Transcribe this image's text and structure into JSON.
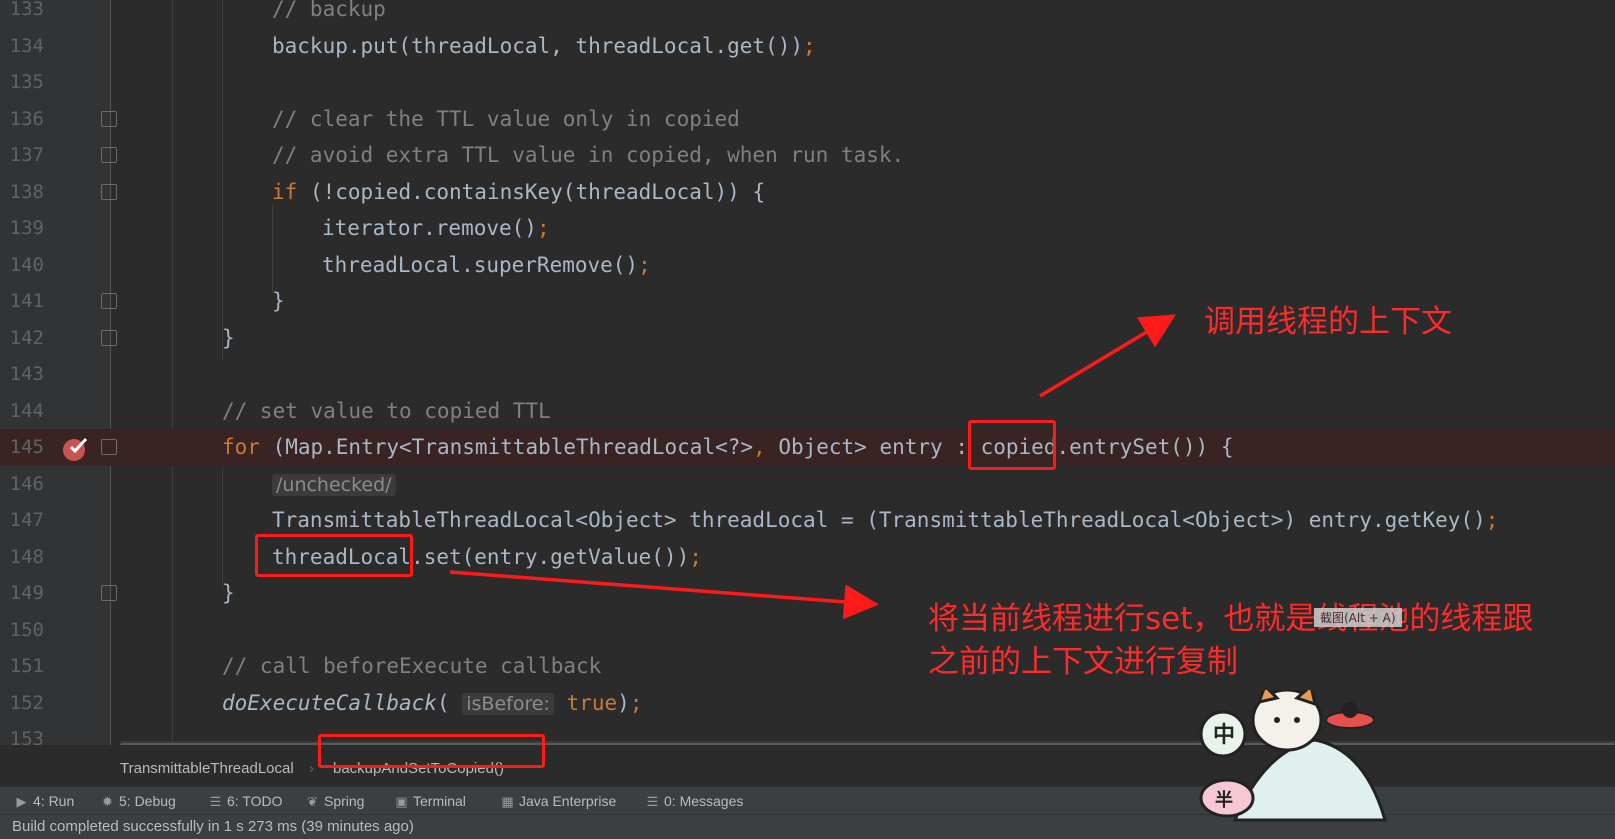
{
  "editor": {
    "lines": [
      {
        "n": "133",
        "t": [
          {
            "c": "cm",
            "v": "// backup"
          }
        ],
        "indent": 2
      },
      {
        "n": "134",
        "t": [
          {
            "c": "",
            "v": "backup.put(threadLocal, threadLocal.get())"
          },
          {
            "c": "kw",
            "v": ";"
          }
        ],
        "indent": 2
      },
      {
        "n": "135",
        "t": [],
        "indent": 2
      },
      {
        "n": "136",
        "t": [
          {
            "c": "cm",
            "v": "// clear the TTL value only in copied"
          }
        ],
        "indent": 2,
        "fold": true
      },
      {
        "n": "137",
        "t": [
          {
            "c": "cm",
            "v": "// avoid extra TTL value in copied, when run task."
          }
        ],
        "indent": 2,
        "fold": true
      },
      {
        "n": "138",
        "t": [
          {
            "c": "kw",
            "v": "if "
          },
          {
            "c": "",
            "v": "(!copied.containsKey(threadLocal)) {"
          }
        ],
        "indent": 2,
        "fold": true
      },
      {
        "n": "139",
        "t": [
          {
            "c": "",
            "v": "iterator.remove()"
          },
          {
            "c": "kw",
            "v": ";"
          }
        ],
        "indent": 3
      },
      {
        "n": "140",
        "t": [
          {
            "c": "",
            "v": "threadLocal.superRemove()"
          },
          {
            "c": "kw",
            "v": ";"
          }
        ],
        "indent": 3
      },
      {
        "n": "141",
        "t": [
          {
            "c": "",
            "v": "}"
          }
        ],
        "indent": 2,
        "fold": true
      },
      {
        "n": "142",
        "t": [
          {
            "c": "",
            "v": "}"
          }
        ],
        "indent": 1,
        "fold": true
      },
      {
        "n": "143",
        "t": [],
        "indent": 1
      },
      {
        "n": "144",
        "t": [
          {
            "c": "cm",
            "v": "// set value to copied TTL"
          }
        ],
        "indent": 1
      },
      {
        "n": "145",
        "t": [
          {
            "c": "kw",
            "v": "for "
          },
          {
            "c": "",
            "v": "(Map.Entry<TransmittableThreadLocal<?>"
          },
          {
            "c": "kw",
            "v": ", "
          },
          {
            "c": "",
            "v": "Object> entry : copied.entrySet()) {"
          }
        ],
        "indent": 1,
        "fold": true,
        "breakpoint": true
      },
      {
        "n": "146",
        "t": [
          {
            "c": "hint",
            "v": "/unchecked/"
          }
        ],
        "indent": 2
      },
      {
        "n": "147",
        "t": [
          {
            "c": "",
            "v": "TransmittableThreadLocal<Object> threadLocal = (TransmittableThreadLocal<Object>) entry.getKey()"
          },
          {
            "c": "kw",
            "v": ";"
          }
        ],
        "indent": 2
      },
      {
        "n": "148",
        "t": [
          {
            "c": "",
            "v": "threadLocal.set(entry.getValue())"
          },
          {
            "c": "kw",
            "v": ";"
          }
        ],
        "indent": 2
      },
      {
        "n": "149",
        "t": [
          {
            "c": "",
            "v": "}"
          }
        ],
        "indent": 1,
        "fold": true
      },
      {
        "n": "150",
        "t": [],
        "indent": 1
      },
      {
        "n": "151",
        "t": [
          {
            "c": "cm",
            "v": "// call beforeExecute callback"
          }
        ],
        "indent": 1
      },
      {
        "n": "152",
        "t": [
          {
            "c": "it",
            "v": "doExecuteCallback"
          },
          {
            "c": "",
            "v": "( "
          },
          {
            "c": "hint",
            "v": "isBefore:"
          },
          {
            "c": "kw",
            "v": " true"
          },
          {
            "c": "",
            "v": ")"
          },
          {
            "c": "kw",
            "v": ";"
          }
        ],
        "indent": 1
      },
      {
        "n": "153",
        "t": [],
        "indent": 1
      }
    ]
  },
  "breadcrumb": {
    "class_name": "TransmittableThreadLocal",
    "method_name": "backupAndSetToCopied()"
  },
  "toolwindows": [
    {
      "key": "run",
      "icon": "play-icon",
      "glyph": "▶",
      "label": "4: Run"
    },
    {
      "key": "debug",
      "icon": "bug-icon",
      "glyph": "✹",
      "label": "5: Debug"
    },
    {
      "key": "todo",
      "icon": "list-icon",
      "glyph": "☰",
      "label": "6: TODO"
    },
    {
      "key": "spring",
      "icon": "leaf-icon",
      "glyph": "❦",
      "label": "Spring"
    },
    {
      "key": "terminal",
      "icon": "terminal-icon",
      "glyph": "▣",
      "label": "Terminal"
    },
    {
      "key": "javaee",
      "icon": "enterprise-icon",
      "glyph": "▦",
      "label": "Java Enterprise"
    },
    {
      "key": "messages",
      "icon": "messages-icon",
      "glyph": "☰",
      "label": "0: Messages"
    }
  ],
  "status": {
    "text": "Build completed successfully in 1 s 273 ms (39 minutes ago)"
  },
  "annotations": {
    "note1": "调用线程的上下文",
    "note2_line1": "将当前线程进行set，也就是线程池的线程跟",
    "note2_line2": "之前的上下文进行复制",
    "tooltip": "截图(Alt + A)",
    "color": "#ff1a1a"
  },
  "sticker": {
    "badge_text": "中",
    "badge_text_2": "半"
  },
  "colors": {
    "background": "#2b2b2b",
    "keyword": "#cc7832",
    "comment": "#808080",
    "text": "#a9b7c6",
    "line_number": "#606366",
    "breakpoint": "#c75450"
  }
}
